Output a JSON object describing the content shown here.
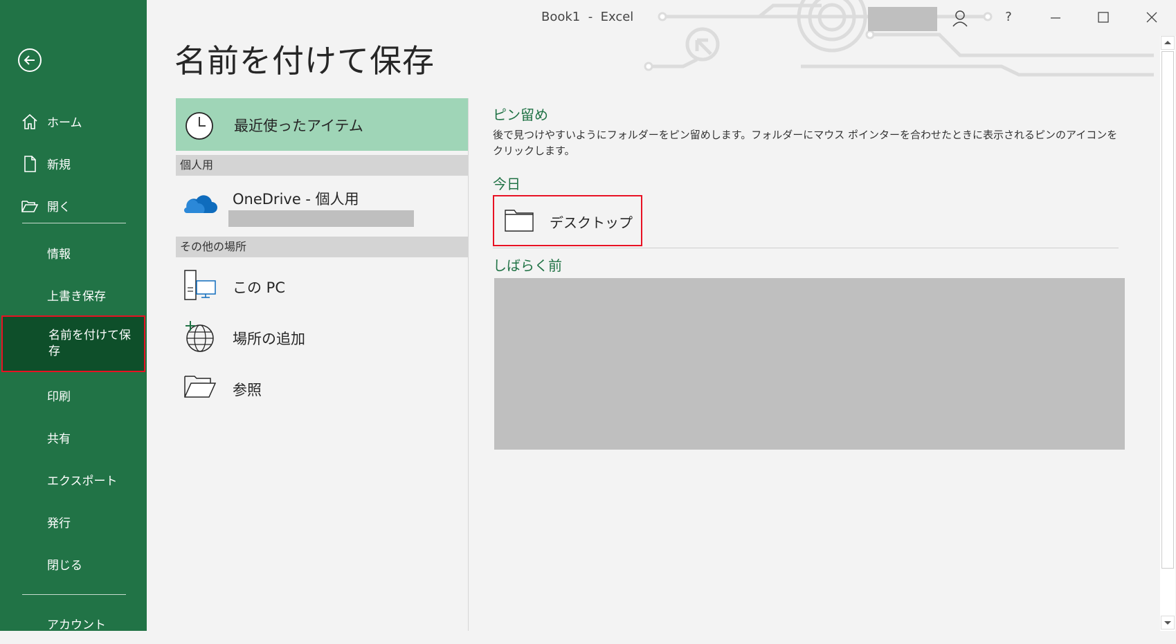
{
  "window": {
    "title": "Book1  -  Excel",
    "help_label": "?"
  },
  "sidebar": {
    "items": [
      {
        "label": "ホーム",
        "icon": "home-icon"
      },
      {
        "label": "新規",
        "icon": "new-document-icon"
      },
      {
        "label": "開く",
        "icon": "open-folder-icon"
      },
      {
        "label": "情報"
      },
      {
        "label": "上書き保存"
      },
      {
        "label": "名前を付けて保存",
        "active": true
      },
      {
        "label": "印刷"
      },
      {
        "label": "共有"
      },
      {
        "label": "エクスポート"
      },
      {
        "label": "発行"
      },
      {
        "label": "閉じる"
      },
      {
        "label": "アカウント"
      }
    ]
  },
  "page": {
    "title": "名前を付けて保存"
  },
  "locations": {
    "recent_label": "最近使ったアイテム",
    "personal_header": "個人用",
    "onedrive_label": "OneDrive - 個人用",
    "other_header": "その他の場所",
    "this_pc_label": "この PC",
    "add_place_label": "場所の追加",
    "browse_label": "参照"
  },
  "pinned": {
    "pin_header": "ピン留め",
    "pin_description": "後で見つけやすいようにフォルダーをピン留めします。フォルダーにマウス ポインターを合わせたときに表示されるピンのアイコンをクリックします。",
    "today_header": "今日",
    "desktop_label": "デスクトップ",
    "earlier_header": "しばらく前"
  },
  "colors": {
    "sidebar": "#217346",
    "sidebar_active": "#0e4f2a",
    "recent_highlight": "#9fd5b7",
    "section_header": "#217346",
    "highlight_border": "#e81123"
  }
}
